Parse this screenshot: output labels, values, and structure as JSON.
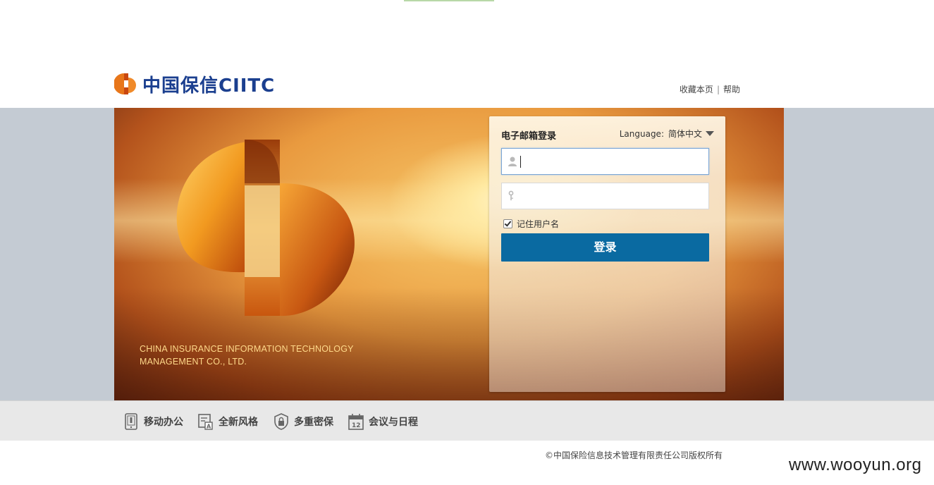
{
  "header": {
    "logo_text": "中国保信CIITC",
    "links": [
      "收藏本页",
      "帮助"
    ],
    "link_separator": "|"
  },
  "hero": {
    "company_en_line1": "CHINA INSURANCE INFORMATION TECHNOLOGY",
    "company_en_line2": "MANAGEMENT CO., LTD."
  },
  "login": {
    "title": "电子邮箱登录",
    "language_label": "Language:",
    "language_value": "简体中文",
    "username_value": "",
    "password_value": "",
    "remember_label": "记住用户名",
    "remember_checked": true,
    "submit_label": "登录"
  },
  "features": [
    {
      "label": "移动办公",
      "icon": "mobile-phone-icon"
    },
    {
      "label": "全新风格",
      "icon": "new-style-icon"
    },
    {
      "label": "多重密保",
      "icon": "lock-shield-icon"
    },
    {
      "label": "会议与日程",
      "icon": "calendar-icon"
    }
  ],
  "footer": {
    "copyright": "©中国保险信息技术管理有限责任公司版权所有",
    "watermark": "www.wooyun.org"
  },
  "colors": {
    "brand_blue": "#1b3f8f",
    "brand_orange": "#e8761a",
    "login_button": "#0a6aa1",
    "band_gray": "#c4cbd3"
  }
}
